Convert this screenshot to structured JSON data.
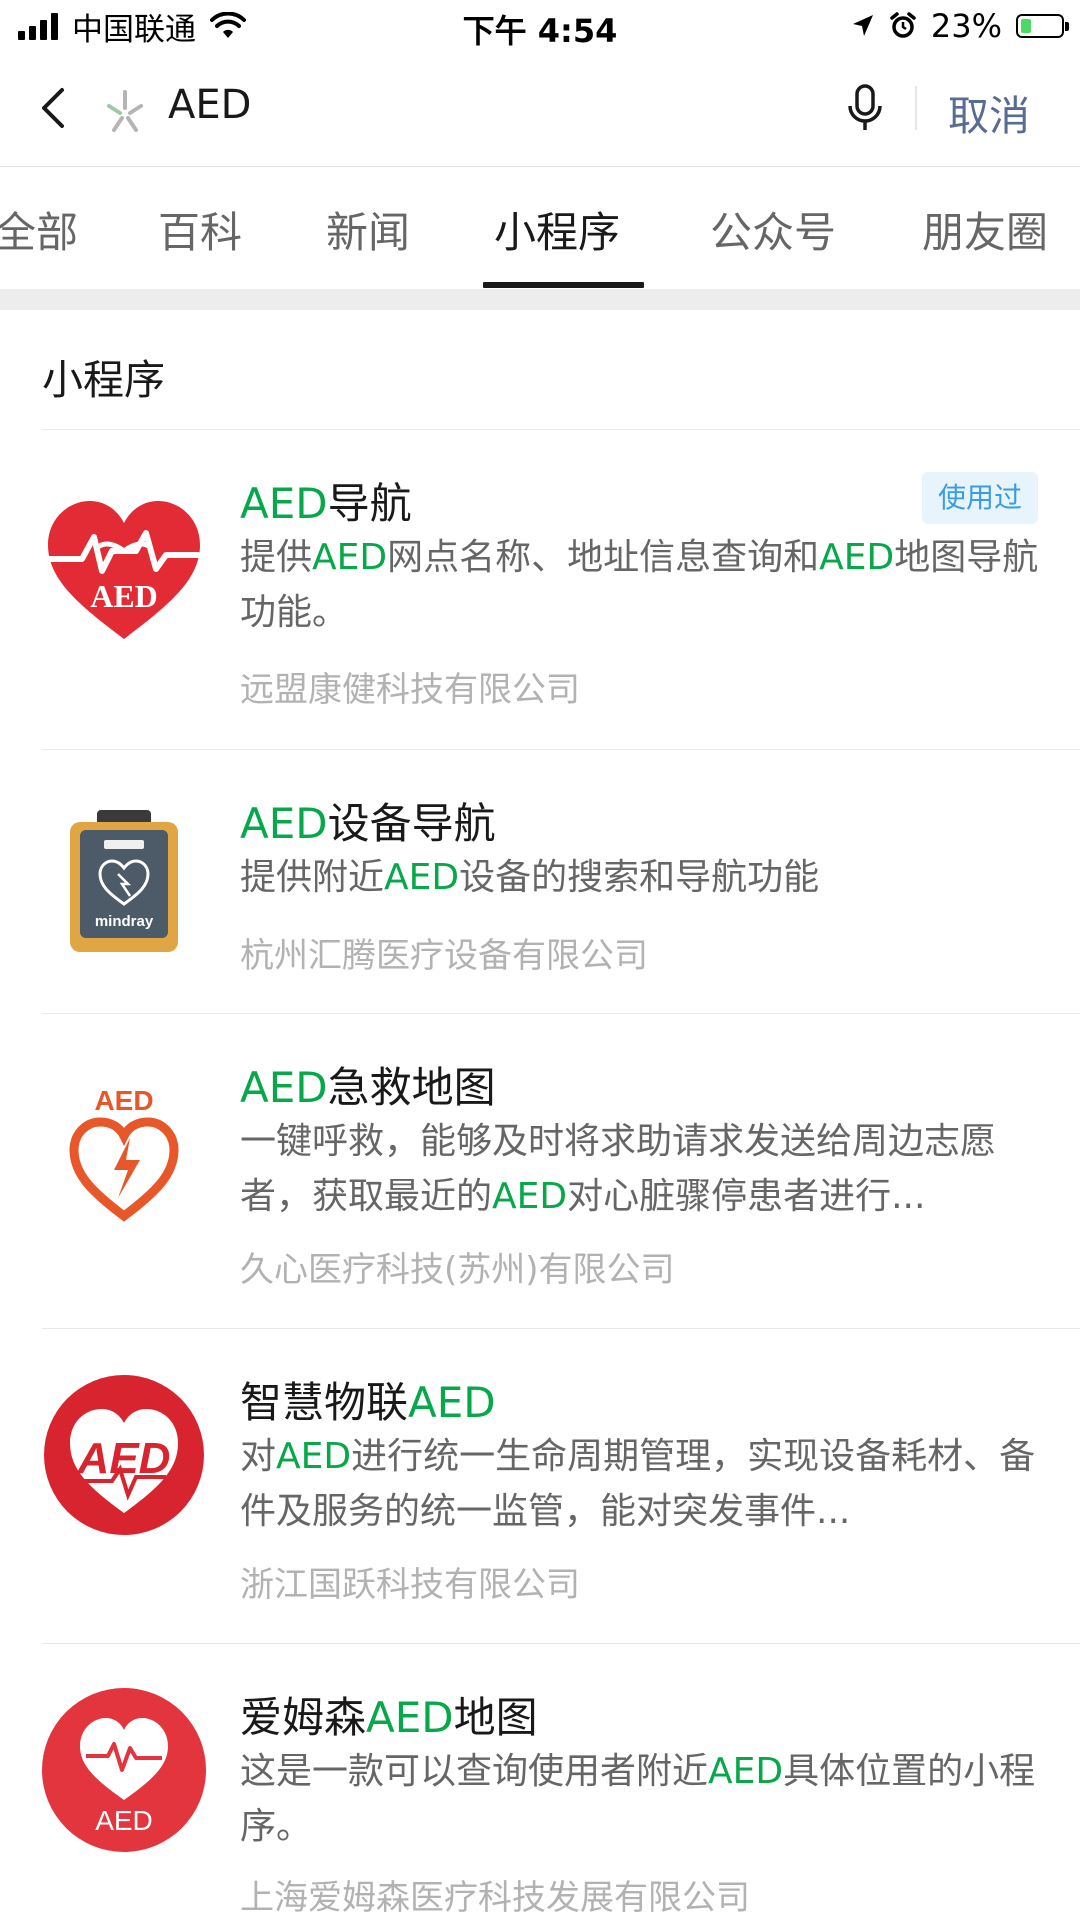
{
  "status_bar": {
    "carrier": "中国联通",
    "time": "下午 4:54",
    "battery_percent": "23%",
    "battery_level": 0.23,
    "icons": [
      "signal-icon",
      "wifi-icon",
      "location-icon",
      "alarm-icon",
      "battery-icon"
    ]
  },
  "search": {
    "query": "AED",
    "cancel_label": "取消"
  },
  "tabs": [
    {
      "label": "全部"
    },
    {
      "label": "百科"
    },
    {
      "label": "新闻"
    },
    {
      "label": "小程序",
      "active": true
    },
    {
      "label": "公众号"
    },
    {
      "label": "朋友圈"
    }
  ],
  "section_title": "小程序",
  "results": [
    {
      "title_hl": "AED",
      "title_rest": "导航",
      "badge": "使用过",
      "desc_parts": [
        "提供",
        "AED",
        "网点名称、地址信息查询和",
        "AED",
        "地图导航功能。"
      ],
      "org": "远盟康健科技有限公司",
      "icon": "aed-heart-handshake-icon"
    },
    {
      "title_hl": "AED",
      "title_rest": "设备导航",
      "desc_parts": [
        "提供附近",
        "AED",
        "设备的搜索和导航功能"
      ],
      "org": "杭州汇腾医疗设备有限公司",
      "icon": "mindray-aed-device-icon",
      "icon_text": "mindray"
    },
    {
      "title_hl": "AED",
      "title_rest": "急救地图",
      "desc_parts": [
        "一键呼救，能够及时将求助请求发送给周边志愿者，获取最近的",
        "AED",
        "对心脏骤停患者进行..."
      ],
      "org": "久心医疗科技(苏州)有限公司",
      "icon": "aed-heart-bolt-icon",
      "icon_text": "AED"
    },
    {
      "title_pre": "智慧物联",
      "title_hl": "AED",
      "desc_parts": [
        "对",
        "AED",
        "进行统一生命周期管理，实现设备耗材、备件及服务的统一监管，能对突发事件..."
      ],
      "org": "浙江国跃科技有限公司",
      "icon": "aed-red-circle-icon",
      "icon_text": "AED"
    },
    {
      "title_pre": "爱姆森",
      "title_hl": "AED",
      "title_rest": "地图",
      "desc_parts": [
        "这是一款可以查询使用者附近",
        "AED",
        "具体位置的小程序。"
      ],
      "org": "上海爱姆森医疗科技发展有限公司",
      "icon": "aed-heart-pulse-icon",
      "icon_text": "AED"
    }
  ],
  "colors": {
    "highlight": "#07a84a",
    "cancel": "#576b95",
    "badge_bg": "#e8f4fc",
    "badge_text": "#3b9be3",
    "muted": "#b2b2b2"
  }
}
